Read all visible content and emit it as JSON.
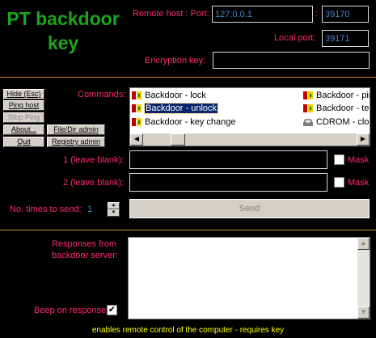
{
  "app_title": "PT backdoor key",
  "connection": {
    "remote_host_label": "Remote host : Port:",
    "remote_host_value": "127.0.0.1",
    "remote_port_value": "39170",
    "local_port_label": "Local port:",
    "local_port_value": "39171",
    "encryption_key_label": "Encryption key:",
    "encryption_key_value": ""
  },
  "buttons": {
    "hide": "Hide (Esc)",
    "ping_host": "Ping host",
    "stop_ping": "Stop Ping",
    "about": "About...",
    "file_dir_admin": "File/Dir admin",
    "quit": "Quit",
    "registry_admin": "Registry admin",
    "send": "Send"
  },
  "commands": {
    "label": "Commands:",
    "items": [
      {
        "label": "Backdoor - lock",
        "icon": "backdoor-icon"
      },
      {
        "label": "Backdoor - unlock",
        "icon": "backdoor-icon",
        "selected": true
      },
      {
        "label": "Backdoor - key change",
        "icon": "backdoor-icon"
      },
      {
        "label": "Backdoor - pin",
        "icon": "backdoor-icon"
      },
      {
        "label": "Backdoor - ter",
        "icon": "backdoor-icon"
      },
      {
        "label": "CDROM - clos",
        "icon": "cdrom-icon"
      }
    ]
  },
  "params": {
    "param1_label": "1 (leave blank):",
    "param2_label": "2 (leave blank):",
    "mask_label": "Mask",
    "times_label": "No. times to send:",
    "times_value": "1"
  },
  "responses": {
    "label": "Responses from backdoor server:",
    "beep_label": "Beep on response",
    "beep_checked": true
  },
  "footer": "enables remote control of the computer - requires key"
}
